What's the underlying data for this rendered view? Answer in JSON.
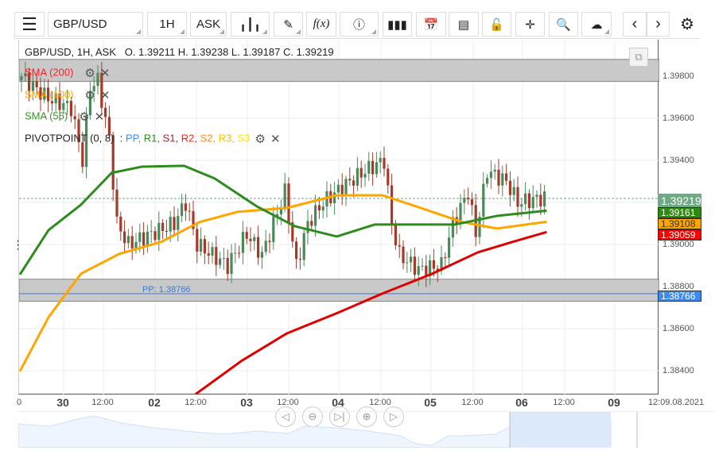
{
  "toolbar": {
    "symbol": "GBP/USD",
    "timeframe": "1H",
    "price_type": "ASK",
    "fx_label": "f(x)"
  },
  "legend": {
    "title": "GBP/USD, 1H, ASK",
    "ohlc": "O. 1.39211 H. 1.39238 L. 1.39187 C. 1.39219",
    "sma200": "SMA (200)",
    "sma100": "SMA (100)",
    "sma55": "SMA (55)",
    "pivot": "PIVOTPOINT (0, 8)",
    "pivot_lines": [
      {
        "t": "PP",
        "c": "#3b8cf0"
      },
      {
        "t": "R1",
        "c": "#2e8b1e"
      },
      {
        "t": "S1",
        "c": "#b22222"
      },
      {
        "t": "R2",
        "c": "#ff2020"
      },
      {
        "t": "S2",
        "c": "#ff8c00"
      },
      {
        "t": "R3",
        "c": "#f2c200"
      },
      {
        "t": "S3",
        "c": "#f5e800"
      }
    ]
  },
  "price_axis": [
    "1.39800",
    "1.39600",
    "1.39400",
    "1.39000",
    "1.38800",
    "1.38600",
    "1.38400"
  ],
  "tags": {
    "last": "1.39219",
    "sma55": "1.39161",
    "sma100": "1.39108",
    "sma200": "1.39059",
    "pp": "1.38766"
  },
  "pp_label": "PP: 1.38766",
  "time_axis": {
    "days": [
      "30",
      "02",
      "03",
      "04",
      "05",
      "06",
      "09"
    ],
    "half": "12:00",
    "end": "12:09.08.2021",
    "first": "0"
  },
  "colors": {
    "sma55": "#2e8b1e",
    "sma100": "#ffa500",
    "sma200": "#e00000",
    "up": "#4a8a5a",
    "down": "#a33a2a",
    "pp": "#3b78d8"
  },
  "chart_data": {
    "type": "candlestick",
    "price_range": [
      1.3825,
      1.3997
    ],
    "price_path": [
      [
        0,
        1.3978
      ],
      [
        1,
        1.398
      ],
      [
        7.5,
        1.397
      ],
      [
        14,
        1.3965
      ],
      [
        17,
        1.394
      ],
      [
        19,
        1.3975
      ],
      [
        21,
        1.3978
      ],
      [
        24,
        1.395
      ],
      [
        26,
        1.391
      ],
      [
        29,
        1.39
      ],
      [
        35,
        1.3905
      ],
      [
        41,
        1.391
      ],
      [
        44,
        1.392
      ],
      [
        47,
        1.39
      ],
      [
        51,
        1.3895
      ],
      [
        55,
        1.389
      ],
      [
        60,
        1.3905
      ],
      [
        64,
        1.3895
      ],
      [
        67,
        1.391
      ],
      [
        70,
        1.3925
      ],
      [
        73,
        1.389
      ],
      [
        76,
        1.391
      ],
      [
        80,
        1.392
      ],
      [
        87,
        1.393
      ],
      [
        91,
        1.3935
      ],
      [
        96,
        1.394
      ],
      [
        98,
        1.391
      ],
      [
        100,
        1.3895
      ],
      [
        105,
        1.3888
      ],
      [
        111,
        1.389
      ],
      [
        114,
        1.391
      ],
      [
        118,
        1.3925
      ],
      [
        120,
        1.3905
      ],
      [
        123,
        1.3935
      ],
      [
        128,
        1.393
      ],
      [
        131,
        1.392
      ],
      [
        137,
        1.3922
      ]
    ],
    "sma55": [
      [
        0,
        1.38857
      ],
      [
        7.5,
        1.39068
      ],
      [
        16,
        1.39189
      ],
      [
        24,
        1.3934
      ],
      [
        32,
        1.3937
      ],
      [
        43,
        1.39374
      ],
      [
        51,
        1.39314
      ],
      [
        62,
        1.39182
      ],
      [
        72,
        1.39087
      ],
      [
        83,
        1.39038
      ],
      [
        93,
        1.39095
      ],
      [
        104,
        1.39095
      ],
      [
        114,
        1.39095
      ],
      [
        125,
        1.39136
      ],
      [
        138,
        1.39161
      ]
    ],
    "sma100": [
      [
        0,
        1.38397
      ],
      [
        7.5,
        1.38654
      ],
      [
        16,
        1.38861
      ],
      [
        26,
        1.38955
      ],
      [
        37,
        1.39012
      ],
      [
        47,
        1.39106
      ],
      [
        57,
        1.39155
      ],
      [
        70,
        1.39174
      ],
      [
        83,
        1.39234
      ],
      [
        95,
        1.39234
      ],
      [
        105,
        1.39174
      ],
      [
        116,
        1.39106
      ],
      [
        125,
        1.39076
      ],
      [
        138,
        1.39108
      ]
    ],
    "sma200": [
      [
        46,
        1.38288
      ],
      [
        58,
        1.38446
      ],
      [
        70,
        1.38578
      ],
      [
        83,
        1.38673
      ],
      [
        95,
        1.38767
      ],
      [
        108,
        1.38861
      ],
      [
        120,
        1.38963
      ],
      [
        129,
        1.39012
      ],
      [
        138,
        1.39059
      ]
    ],
    "pivot_pp": 1.38766,
    "last": 1.39219,
    "zones": [
      [
        1.39775,
        1.3988
      ],
      [
        1.3873,
        1.38835
      ]
    ]
  }
}
